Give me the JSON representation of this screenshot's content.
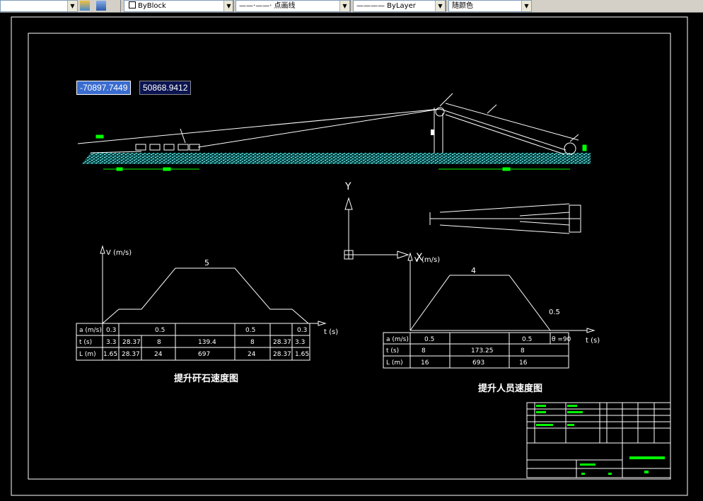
{
  "toolbar": {
    "linetype_label": "ByBlock",
    "line_style_label": "——·——· 点画线",
    "lineweight_label": "———— ByLayer",
    "color_label": "随颜色"
  },
  "coords": {
    "x": "-70897.7449",
    "y": "50868.9412"
  },
  "drawing": {
    "ucs_y_label": "Y",
    "ucs_x_label": "X",
    "chart1_title": "提升矸石速度图",
    "chart2_title": "提升人员速度图",
    "chart1_yaxis": "V (m/s)",
    "chart1_xaxis": "t (s)",
    "chart2_yaxis": "V (m/s)",
    "chart2_xaxis": "t (s)",
    "chart1_peak": "5",
    "chart2_peak": "4",
    "chart2_side": "0.5",
    "chart2_extra": "θ =90"
  },
  "table1": {
    "rows": [
      [
        "a (m/s)",
        "0.3",
        "",
        "0.5",
        "",
        "0.5",
        "",
        "0.3"
      ],
      [
        "t (s)",
        "3.3",
        "28.37",
        "8",
        "139.4",
        "8",
        "28.37",
        "3.3"
      ],
      [
        "L (m)",
        "1.65",
        "28.37",
        "24",
        "697",
        "24",
        "28.37",
        "1.65"
      ]
    ]
  },
  "table2": {
    "rows": [
      [
        "a (m/s)",
        "0.5",
        "",
        "0.5"
      ],
      [
        "t (s)",
        "8",
        "173.25",
        "8"
      ],
      [
        "L (m)",
        "16",
        "693",
        "16"
      ]
    ]
  }
}
